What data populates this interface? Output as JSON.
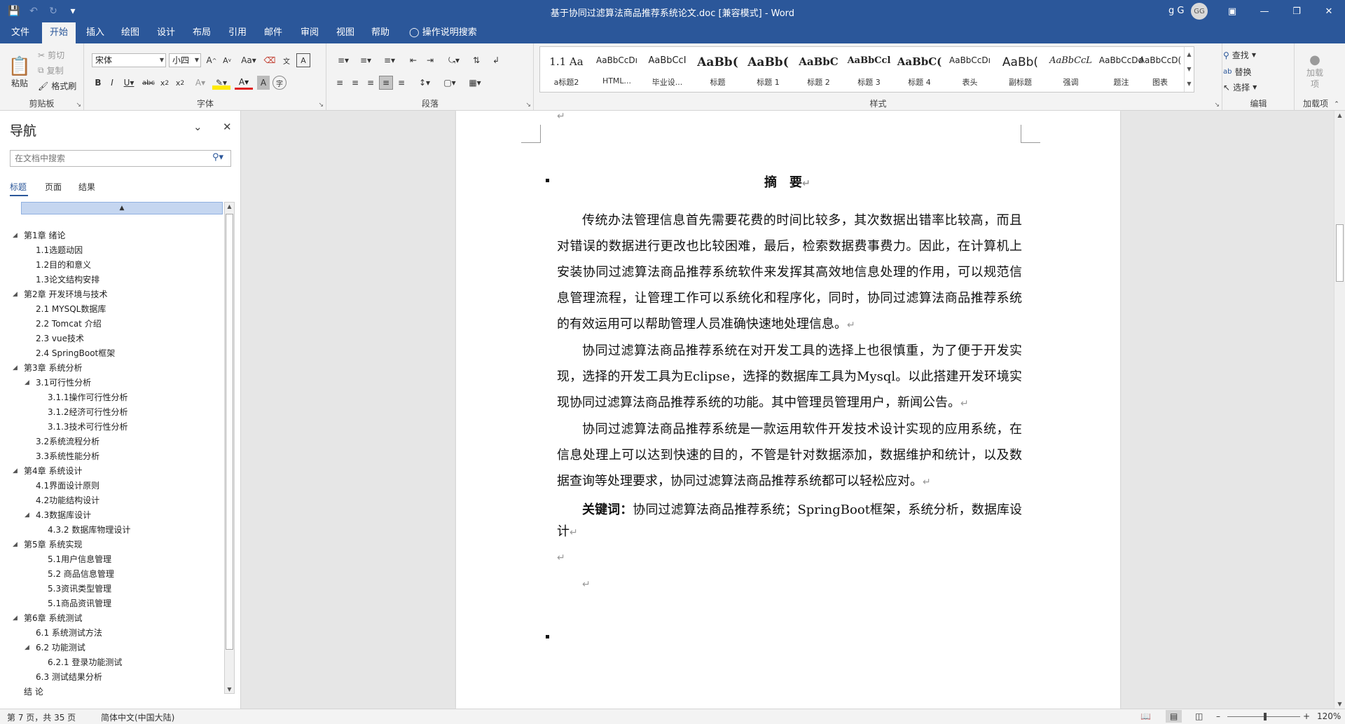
{
  "window": {
    "title": "基于协同过滤算法商品推荐系统论文.doc [兼容模式] - Word",
    "user_name": "g G",
    "user_initials": "GG"
  },
  "ribbon_tabs": [
    "文件",
    "开始",
    "插入",
    "绘图",
    "设计",
    "布局",
    "引用",
    "邮件",
    "审阅",
    "视图",
    "帮助"
  ],
  "active_tab": "开始",
  "tell_me": "操作说明搜索",
  "clipboard": {
    "paste": "粘贴",
    "cut": "剪切",
    "copy": "复制",
    "format_painter": "格式刷",
    "label": "剪贴板"
  },
  "font": {
    "name": "宋体",
    "size": "小四",
    "label": "字体"
  },
  "paragraph": {
    "label": "段落"
  },
  "styles": {
    "label": "样式",
    "items": [
      {
        "preview": "1.1  Aa",
        "name": "a标题2"
      },
      {
        "preview": "AaBbCcDı",
        "name": "HTML..."
      },
      {
        "preview": "AaBbCcI",
        "name": "毕业设..."
      },
      {
        "preview": "AaBb(",
        "name": "标题"
      },
      {
        "preview": "AaBb(",
        "name": "标题 1"
      },
      {
        "preview": "AaBbC",
        "name": "标题 2"
      },
      {
        "preview": "AaBbCcl",
        "name": "标题 3"
      },
      {
        "preview": "AaBbC(",
        "name": "标题 4"
      },
      {
        "preview": "AaBbCcDı",
        "name": "表头"
      },
      {
        "preview": "AaBb(",
        "name": "副标题"
      },
      {
        "preview": "AaBbCcL",
        "name": "强调"
      },
      {
        "preview": "AaBbCcDd",
        "name": "题注"
      },
      {
        "preview": "AaBbCcD(",
        "name": "图表"
      }
    ]
  },
  "editing": {
    "find": "查找",
    "replace": "替换",
    "select": "选择",
    "label": "编辑"
  },
  "addins": {
    "button": "加载项",
    "label": "加载项"
  },
  "nav": {
    "title": "导航",
    "search_placeholder": "在文档中搜索",
    "tabs": [
      "标题",
      "页面",
      "结果"
    ],
    "outline": [
      {
        "text": "第1章 绪论",
        "level": 1,
        "expanded": true
      },
      {
        "text": "1.1选题动因",
        "level": 2
      },
      {
        "text": "1.2目的和意义",
        "level": 2
      },
      {
        "text": "1.3论文结构安排",
        "level": 2
      },
      {
        "text": "第2章 开发环境与技术",
        "level": 1,
        "expanded": true
      },
      {
        "text": "2.1 MYSQL数据库",
        "level": 2
      },
      {
        "text": "2.2 Tomcat 介绍",
        "level": 2
      },
      {
        "text": "2.3 vue技术",
        "level": 2
      },
      {
        "text": "2.4 SpringBoot框架",
        "level": 2
      },
      {
        "text": "第3章 系统分析",
        "level": 1,
        "expanded": true
      },
      {
        "text": "3.1可行性分析",
        "level": 2,
        "expanded": true
      },
      {
        "text": "3.1.1操作可行性分析",
        "level": 3
      },
      {
        "text": "3.1.2经济可行性分析",
        "level": 3
      },
      {
        "text": "3.1.3技术可行性分析",
        "level": 3
      },
      {
        "text": "3.2系统流程分析",
        "level": 2
      },
      {
        "text": "3.3系统性能分析",
        "level": 2
      },
      {
        "text": "第4章 系统设计",
        "level": 1,
        "expanded": true
      },
      {
        "text": "4.1界面设计原则",
        "level": 2
      },
      {
        "text": "4.2功能结构设计",
        "level": 2
      },
      {
        "text": "4.3数据库设计",
        "level": 2,
        "expanded": true
      },
      {
        "text": "4.3.2 数据库物理设计",
        "level": 3
      },
      {
        "text": "第5章 系统实现",
        "level": 1,
        "expanded": true
      },
      {
        "text": "5.1用户信息管理",
        "level": 3
      },
      {
        "text": "5.2 商品信息管理",
        "level": 3
      },
      {
        "text": "5.3资讯类型管理",
        "level": 3
      },
      {
        "text": "5.1商品资讯管理",
        "level": 3
      },
      {
        "text": "第6章 系统测试",
        "level": 1,
        "expanded": true
      },
      {
        "text": "6.1 系统测试方法",
        "level": 2
      },
      {
        "text": "6.2 功能测试",
        "level": 2,
        "expanded": true
      },
      {
        "text": "6.2.1 登录功能测试",
        "level": 3
      },
      {
        "text": "6.3 测试结果分析",
        "level": 2
      },
      {
        "text": "结  论",
        "level": 1
      }
    ]
  },
  "document": {
    "heading": "摘　要",
    "paragraphs": [
      "传统办法管理信息首先需要花费的时间比较多，其次数据出错率比较高，而且对错误的数据进行更改也比较困难，最后，检索数据费事费力。因此，在计算机上安装协同过滤算法商品推荐系统软件来发挥其高效地信息处理的作用，可以规范信息管理流程，让管理工作可以系统化和程序化，同时，协同过滤算法商品推荐系统的有效运用可以帮助管理人员准确快速地处理信息。",
      "协同过滤算法商品推荐系统在对开发工具的选择上也很慎重，为了便于开发实现，选择的开发工具为Eclipse，选择的数据库工具为Mysql。以此搭建开发环境实现协同过滤算法商品推荐系统的功能。其中管理员管理用户，新闻公告。",
      "协同过滤算法商品推荐系统是一款运用软件开发技术设计实现的应用系统，在信息处理上可以达到快速的目的，不管是针对数据添加，数据维护和统计，以及数据查询等处理要求，协同过滤算法商品推荐系统都可以轻松应对。"
    ],
    "keywords_label": "关键词：",
    "keywords": "协同过滤算法商品推荐系统；SpringBoot框架，系统分析，数据库设计"
  },
  "status": {
    "page": "第 7 页，共 35 页",
    "language": "简体中文(中国大陆)",
    "zoom": "120%"
  },
  "colors": {
    "accent": "#2b579a",
    "ribbon_bg": "#f3f3f3",
    "workspace": "#e6e6e6"
  }
}
